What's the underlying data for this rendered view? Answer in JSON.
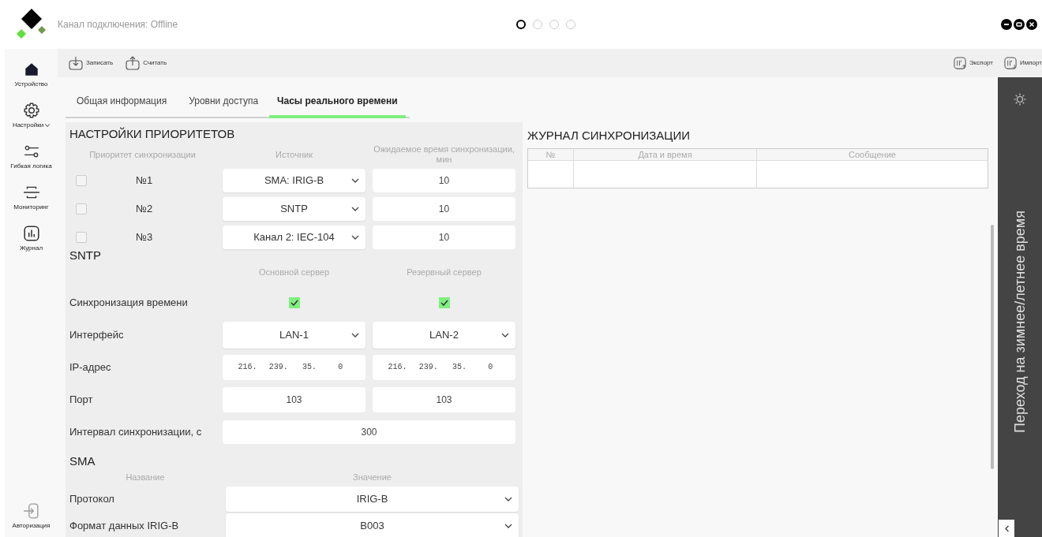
{
  "header": {
    "connection_status": "Канал подключения: Offline",
    "pager": [
      {
        "selected": true
      },
      {
        "selected": false
      },
      {
        "selected": false
      },
      {
        "selected": false
      }
    ]
  },
  "sidebar": {
    "items": [
      {
        "label": "Устройство",
        "dropdown": false
      },
      {
        "label": "Настройки",
        "dropdown": true
      },
      {
        "label": "Гибкая логика",
        "dropdown": false
      },
      {
        "label": "Мониторинг",
        "dropdown": false
      },
      {
        "label": "Журнал",
        "dropdown": false
      }
    ],
    "footer_item": {
      "label": "Авторизация"
    }
  },
  "toolbar": {
    "left_actions": [
      "Записать",
      "Считать"
    ],
    "right_actions": [
      "Экспорт",
      "Импорт"
    ]
  },
  "tabs": [
    {
      "label": "Общая информация",
      "selected": false
    },
    {
      "label": "Уровни доступа",
      "selected": false
    },
    {
      "label": "Часы реального времени",
      "selected": true
    }
  ],
  "priority_settings": {
    "title": "НАСТРОЙКИ ПРИОРИТЕТОВ",
    "columns": [
      "Приоритет синхронизации",
      "Источник",
      "Ожидаемое время синхронизации, мин"
    ],
    "rows": [
      {
        "checked": false,
        "label": "№1",
        "source": "SMA: IRIG-B",
        "wait": "10"
      },
      {
        "checked": false,
        "label": "№2",
        "source": "SNTP",
        "wait": "10"
      },
      {
        "checked": false,
        "label": "№3",
        "source": "Канал 2: IEC-104",
        "wait": "10"
      }
    ]
  },
  "sntp": {
    "title": "SNTP",
    "columns": [
      "Основной сервер",
      "Резервный сервер"
    ],
    "rows": [
      {
        "kind": "checkbox",
        "label": "Синхронизация времени",
        "values": [
          {
            "checked": true
          },
          {
            "checked": true
          }
        ]
      },
      {
        "kind": "select",
        "label": "Интерфейс",
        "values": [
          "LAN-1",
          "LAN-2"
        ]
      },
      {
        "kind": "ip",
        "label": "IP-адрес",
        "values": [
          [
            "216.",
            "239.",
            "35.",
            "0"
          ],
          [
            "216.",
            "239.",
            "35.",
            "0"
          ]
        ]
      },
      {
        "kind": "input",
        "label": "Порт",
        "values": [
          "103",
          "103"
        ]
      },
      {
        "kind": "wide_input",
        "label": "Интервал синхронизации, с",
        "value": "300"
      }
    ]
  },
  "sma": {
    "title": "SMA",
    "columns": [
      "Название",
      "Значение"
    ],
    "rows": [
      {
        "label": "Протокол",
        "value": "IRIG-B"
      },
      {
        "label": "Формат данных IRIG-B",
        "value": "B003"
      }
    ]
  },
  "journal": {
    "title": "ЖУРНАЛ СИНХРОНИЗАЦИИ",
    "columns": [
      "№",
      "Дата и время",
      "Сообщение"
    ]
  },
  "side_panel": {
    "label": "Переход на зимнее/летнее время"
  }
}
